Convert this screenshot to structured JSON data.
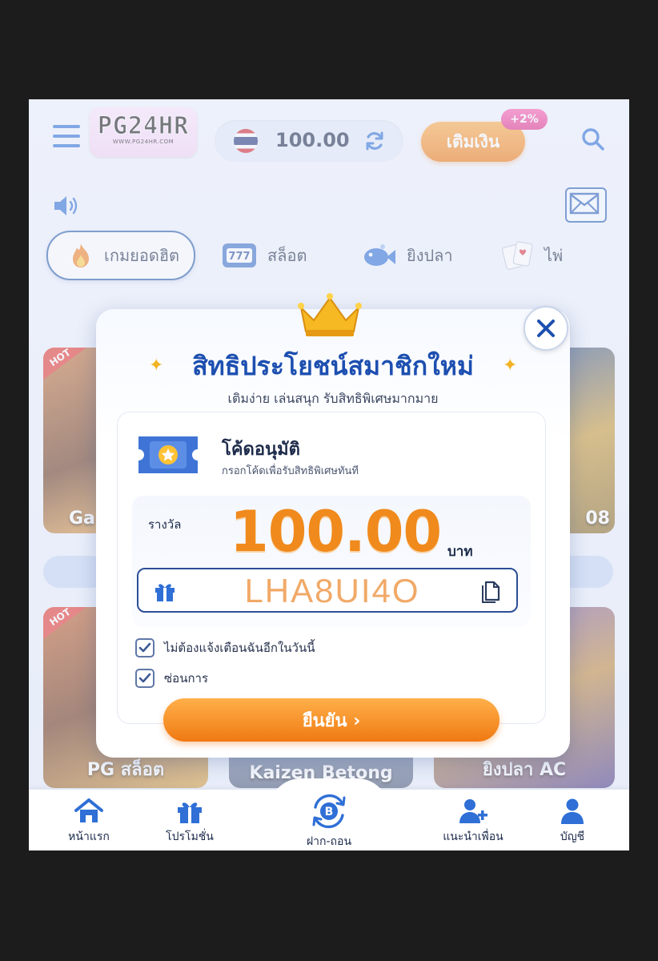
{
  "header": {
    "logo_text": "PG24HR",
    "logo_url_text": "WWW.PG24HR.COM",
    "balance": "100.00",
    "topup_label": "เติมเงิน",
    "bonus_badge": "+2%"
  },
  "categories": [
    {
      "label": "เกมยอดฮิต",
      "icon": "fire-icon",
      "active": true
    },
    {
      "label": "สล็อต",
      "icon": "slot-machine-icon",
      "active": false
    },
    {
      "label": "ยิงปลา",
      "icon": "fish-icon",
      "active": false
    },
    {
      "label": "ไพ่",
      "icon": "cards-icon",
      "active": false
    }
  ],
  "background_tiles": {
    "hot_badge": "HOT",
    "captions": [
      "Ga",
      "08",
      "PG  สล็อต",
      "Kaizen Betong",
      "ยิงปลา AC"
    ]
  },
  "modal": {
    "title": "สิทธิประโยชน์สมาชิกใหม่",
    "subtitle": "เติมง่าย เล่นสนุก รับสิทธิพิเศษมากมาย",
    "code_title": "โค้ดอนุมัติ",
    "code_subtitle": "กรอกโค้ดเพื่อรับสิทธิพิเศษทันที",
    "reward_label": "รางวัล",
    "reward_amount": "100.00",
    "reward_unit": "บาท",
    "code_value": "LHA8UI4O",
    "checkbox_1": {
      "label": "ไม่ต้องแจ้งเตือนฉันอีกในวันนี้",
      "checked": true
    },
    "checkbox_2": {
      "label": "ซ่อนการ",
      "checked": true
    },
    "confirm_label": "ยืนยัน  ›"
  },
  "bottom_nav": [
    {
      "label": "หน้าแรก",
      "icon": "home-icon"
    },
    {
      "label": "โปรโมชั่น",
      "icon": "gift-icon"
    },
    {
      "label": "ฝาก-ถอน",
      "icon": "bitcoin-exchange-icon"
    },
    {
      "label": "แนะนำเพื่อน",
      "icon": "add-friend-icon"
    },
    {
      "label": "บัญชี",
      "icon": "user-icon"
    }
  ],
  "colors": {
    "primary_blue": "#1d4fb0",
    "accent_orange": "#f08a1c",
    "badge_pink": "#e02f86"
  }
}
